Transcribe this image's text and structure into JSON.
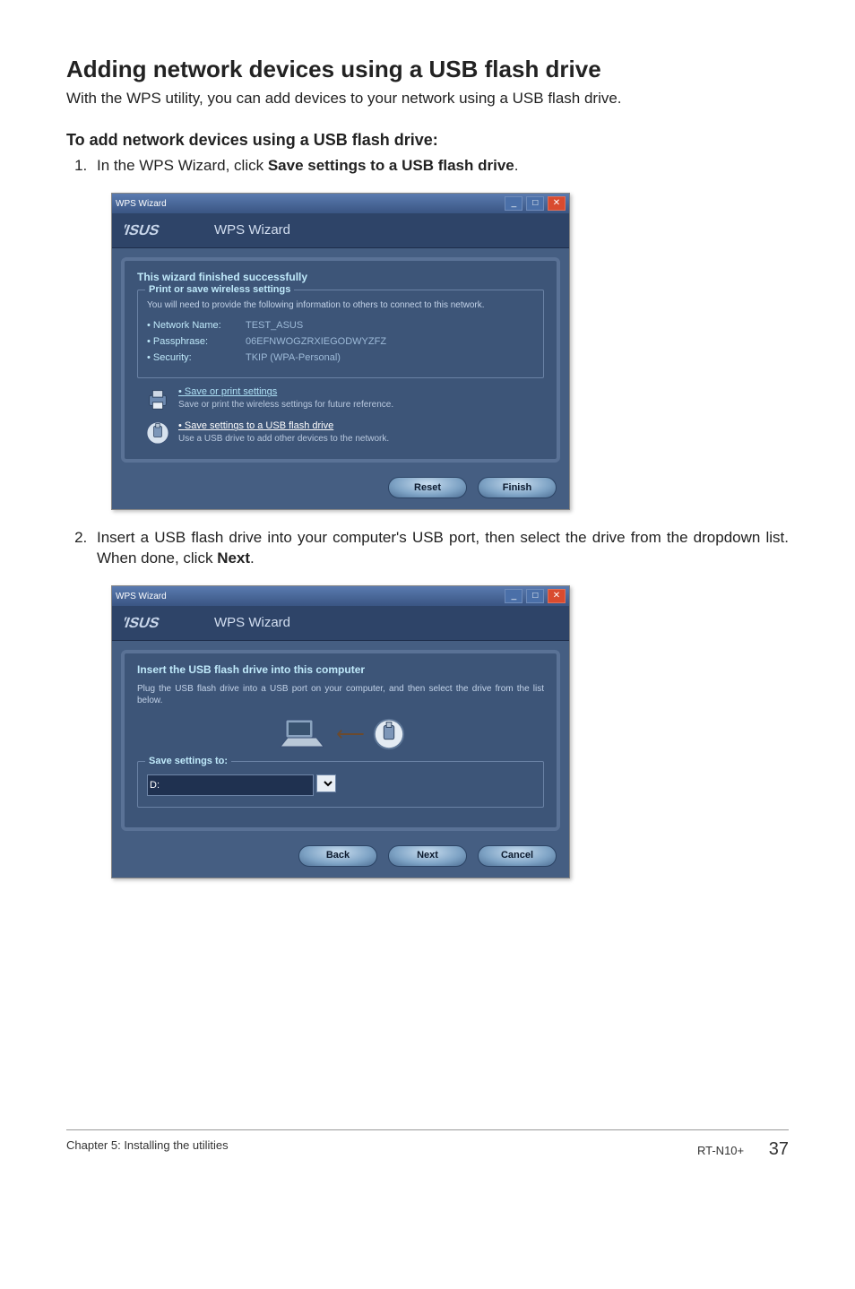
{
  "heading": "Adding network devices using a USB flash drive",
  "intro": "With the WPS utility, you can add devices to your network using a USB flash drive.",
  "subheading": "To add network devices using a USB flash drive:",
  "steps": {
    "s1_pre": "In the WPS Wizard, click ",
    "s1_bold": "Save settings to a USB flash drive",
    "s1_post": ".",
    "s2_pre": "Insert a USB flash drive into your computer's USB port, then select the drive from the dropdown list. When done, click ",
    "s2_bold": "Next",
    "s2_post": "."
  },
  "screenshot1": {
    "titlebar": "WPS Wizard",
    "brand": "WPS Wizard",
    "panel_title": "This wizard finished successfully",
    "fs_legend": "Print or save wireless settings",
    "fs_note": "You will need to provide the following information to others to connect to this network.",
    "kv": {
      "k1": "Network Name:",
      "v1": "TEST_ASUS",
      "k2": "Passphrase:",
      "v2": "06EFNWOGZRXIEGODWYZFZ",
      "k3": "Security:",
      "v3": "TKIP (WPA-Personal)"
    },
    "opt1_title": "Save or print settings",
    "opt1_desc": "Save or print the wireless settings for future reference.",
    "opt2_title": "Save settings to a USB flash drive",
    "opt2_desc": "Use a USB drive to add other devices to the network.",
    "btn_reset": "Reset",
    "btn_finish": "Finish"
  },
  "screenshot2": {
    "titlebar": "WPS Wizard",
    "brand": "WPS Wizard",
    "panel_title": "Insert the USB flash drive into this computer",
    "desc": "Plug the USB flash drive into a USB port on your computer, and then select the drive from the list below.",
    "fs_legend": "Save settings to:",
    "input_value": "D:",
    "btn_back": "Back",
    "btn_next": "Next",
    "btn_cancel": "Cancel"
  },
  "footer": {
    "left": "Chapter 5: Installing the utilities",
    "right_model": "RT-N10+",
    "page": "37"
  }
}
